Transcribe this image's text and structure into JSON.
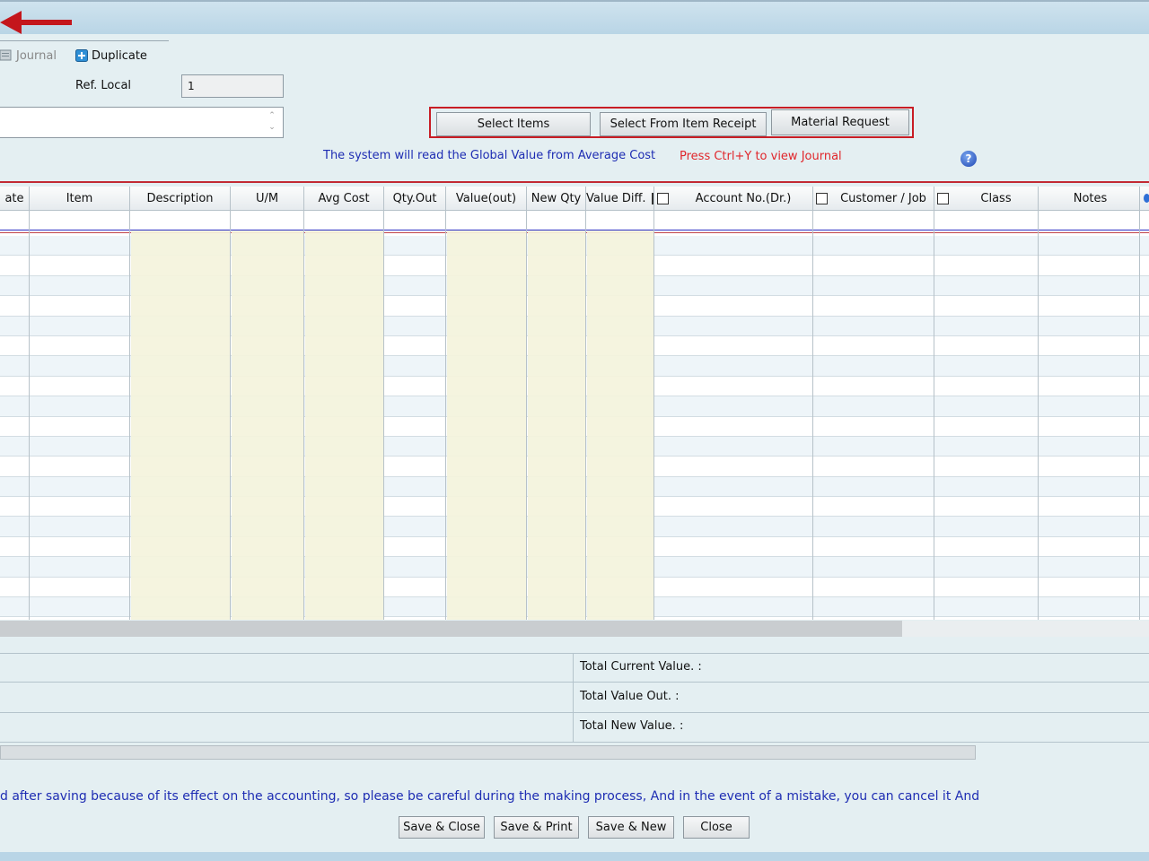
{
  "toolbar": {
    "journal_label": "Journal",
    "duplicate_label": "Duplicate"
  },
  "form": {
    "ref_local_label": "Ref. Local",
    "ref_local_value": "1"
  },
  "actions": {
    "select_items": "Select Items",
    "select_from_receipt": "Select From Item Receipt",
    "material_request": "Material Request"
  },
  "info": {
    "global_value_note": "The system will read the Global Value from Average Cost",
    "journal_hint": "Press Ctrl+Y to view Journal",
    "help_glyph": "?"
  },
  "grid": {
    "columns": [
      {
        "label": "ate",
        "checkbox": false
      },
      {
        "label": "Item",
        "checkbox": false
      },
      {
        "label": "Description",
        "checkbox": false
      },
      {
        "label": "U/M",
        "checkbox": false
      },
      {
        "label": "Avg Cost",
        "checkbox": false
      },
      {
        "label": "Qty.Out",
        "checkbox": false
      },
      {
        "label": "Value(out)",
        "checkbox": false
      },
      {
        "label": "New Qty",
        "checkbox": false
      },
      {
        "label": "Value Diff.",
        "checkbox": true
      },
      {
        "label": "Account No.(Dr.)",
        "checkbox": true
      },
      {
        "label": "Customer / Job",
        "checkbox": true
      },
      {
        "label": "Class",
        "checkbox": true
      },
      {
        "label": "Notes",
        "checkbox": false
      }
    ],
    "row_count": 19
  },
  "totals": {
    "current_value": "Total Current Value. :",
    "value_out": "Total Value Out. :",
    "new_value": "Total New Value. :"
  },
  "notice": "d after saving because of its effect on the accounting, so please be careful during the making process, And in the event of a mistake, you can cancel it And",
  "footer": {
    "save_close": "Save & Close",
    "save_print": "Save & Print",
    "save_new": "Save & New",
    "close": "Close"
  },
  "colors": {
    "accent_red": "#c81d25",
    "info_blue": "#1e2db3",
    "hint_red": "#e0262b",
    "shaded_column": "#f4f3dc"
  }
}
